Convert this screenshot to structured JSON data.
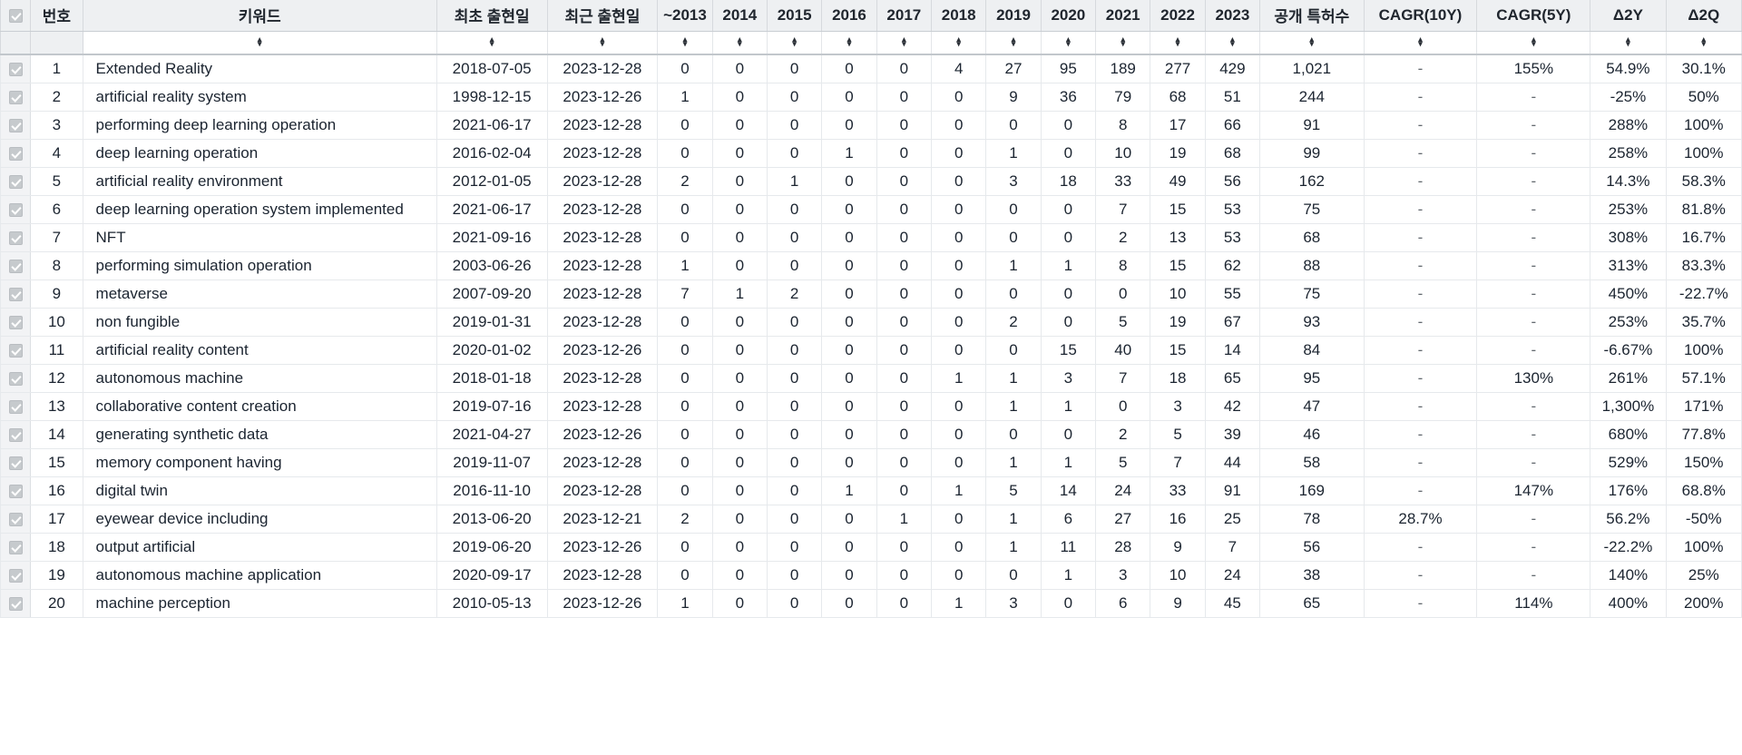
{
  "table": {
    "columns": [
      {
        "key": "check",
        "label": "",
        "sortable": false
      },
      {
        "key": "no",
        "label": "번호",
        "sortable": false
      },
      {
        "key": "kw",
        "label": "키워드",
        "sortable": true
      },
      {
        "key": "first",
        "label": "최초 출현일",
        "sortable": true
      },
      {
        "key": "last",
        "label": "최근 출현일",
        "sortable": true
      },
      {
        "key": "y2013",
        "label": "~2013",
        "sortable": true
      },
      {
        "key": "y2014",
        "label": "2014",
        "sortable": true
      },
      {
        "key": "y2015",
        "label": "2015",
        "sortable": true
      },
      {
        "key": "y2016",
        "label": "2016",
        "sortable": true
      },
      {
        "key": "y2017",
        "label": "2017",
        "sortable": true
      },
      {
        "key": "y2018",
        "label": "2018",
        "sortable": true
      },
      {
        "key": "y2019",
        "label": "2019",
        "sortable": true
      },
      {
        "key": "y2020",
        "label": "2020",
        "sortable": true
      },
      {
        "key": "y2021",
        "label": "2021",
        "sortable": true
      },
      {
        "key": "y2022",
        "label": "2022",
        "sortable": true
      },
      {
        "key": "y2023",
        "label": "2023",
        "sortable": true
      },
      {
        "key": "total",
        "label": "공개 특허수",
        "sortable": true
      },
      {
        "key": "cagr10",
        "label": "CAGR(10Y)",
        "sortable": true
      },
      {
        "key": "cagr5",
        "label": "CAGR(5Y)",
        "sortable": true
      },
      {
        "key": "d2y",
        "label": "Δ2Y",
        "sortable": true
      },
      {
        "key": "d2q",
        "label": "Δ2Q",
        "sortable": true
      }
    ],
    "sort_icon": {
      "up": "▴",
      "down": "▾"
    },
    "checkbox": {
      "checked": true,
      "glyph": "check-icon"
    },
    "rows": [
      {
        "no": "1",
        "kw": "Extended Reality",
        "first": "2018-07-05",
        "last": "2023-12-28",
        "years": [
          "0",
          "0",
          "0",
          "0",
          "0",
          "4",
          "27",
          "95",
          "189",
          "277",
          "429"
        ],
        "total": "1,021",
        "cagr10": "-",
        "cagr5": "155%",
        "d2y": "54.9%",
        "d2q": "30.1%"
      },
      {
        "no": "2",
        "kw": "artificial reality system",
        "first": "1998-12-15",
        "last": "2023-12-26",
        "years": [
          "1",
          "0",
          "0",
          "0",
          "0",
          "0",
          "9",
          "36",
          "79",
          "68",
          "51"
        ],
        "total": "244",
        "cagr10": "-",
        "cagr5": "-",
        "d2y": "-25%",
        "d2q": "50%"
      },
      {
        "no": "3",
        "kw": "performing deep learning operation",
        "first": "2021-06-17",
        "last": "2023-12-28",
        "years": [
          "0",
          "0",
          "0",
          "0",
          "0",
          "0",
          "0",
          "0",
          "8",
          "17",
          "66"
        ],
        "total": "91",
        "cagr10": "-",
        "cagr5": "-",
        "d2y": "288%",
        "d2q": "100%"
      },
      {
        "no": "4",
        "kw": "deep learning operation",
        "first": "2016-02-04",
        "last": "2023-12-28",
        "years": [
          "0",
          "0",
          "0",
          "1",
          "0",
          "0",
          "1",
          "0",
          "10",
          "19",
          "68"
        ],
        "total": "99",
        "cagr10": "-",
        "cagr5": "-",
        "d2y": "258%",
        "d2q": "100%"
      },
      {
        "no": "5",
        "kw": "artificial reality environment",
        "first": "2012-01-05",
        "last": "2023-12-28",
        "years": [
          "2",
          "0",
          "1",
          "0",
          "0",
          "0",
          "3",
          "18",
          "33",
          "49",
          "56"
        ],
        "total": "162",
        "cagr10": "-",
        "cagr5": "-",
        "d2y": "14.3%",
        "d2q": "58.3%"
      },
      {
        "no": "6",
        "kw": "deep learning operation system implemented",
        "first": "2021-06-17",
        "last": "2023-12-28",
        "years": [
          "0",
          "0",
          "0",
          "0",
          "0",
          "0",
          "0",
          "0",
          "7",
          "15",
          "53"
        ],
        "total": "75",
        "cagr10": "-",
        "cagr5": "-",
        "d2y": "253%",
        "d2q": "81.8%"
      },
      {
        "no": "7",
        "kw": "NFT",
        "first": "2021-09-16",
        "last": "2023-12-28",
        "years": [
          "0",
          "0",
          "0",
          "0",
          "0",
          "0",
          "0",
          "0",
          "2",
          "13",
          "53"
        ],
        "total": "68",
        "cagr10": "-",
        "cagr5": "-",
        "d2y": "308%",
        "d2q": "16.7%"
      },
      {
        "no": "8",
        "kw": "performing simulation operation",
        "first": "2003-06-26",
        "last": "2023-12-28",
        "years": [
          "1",
          "0",
          "0",
          "0",
          "0",
          "0",
          "1",
          "1",
          "8",
          "15",
          "62"
        ],
        "total": "88",
        "cagr10": "-",
        "cagr5": "-",
        "d2y": "313%",
        "d2q": "83.3%"
      },
      {
        "no": "9",
        "kw": "metaverse",
        "first": "2007-09-20",
        "last": "2023-12-28",
        "years": [
          "7",
          "1",
          "2",
          "0",
          "0",
          "0",
          "0",
          "0",
          "0",
          "10",
          "55"
        ],
        "total": "75",
        "cagr10": "-",
        "cagr5": "-",
        "d2y": "450%",
        "d2q": "-22.7%"
      },
      {
        "no": "10",
        "kw": "non fungible",
        "first": "2019-01-31",
        "last": "2023-12-28",
        "years": [
          "0",
          "0",
          "0",
          "0",
          "0",
          "0",
          "2",
          "0",
          "5",
          "19",
          "67"
        ],
        "total": "93",
        "cagr10": "-",
        "cagr5": "-",
        "d2y": "253%",
        "d2q": "35.7%"
      },
      {
        "no": "11",
        "kw": "artificial reality content",
        "first": "2020-01-02",
        "last": "2023-12-26",
        "years": [
          "0",
          "0",
          "0",
          "0",
          "0",
          "0",
          "0",
          "15",
          "40",
          "15",
          "14"
        ],
        "total": "84",
        "cagr10": "-",
        "cagr5": "-",
        "d2y": "-6.67%",
        "d2q": "100%"
      },
      {
        "no": "12",
        "kw": "autonomous machine",
        "first": "2018-01-18",
        "last": "2023-12-28",
        "years": [
          "0",
          "0",
          "0",
          "0",
          "0",
          "1",
          "1",
          "3",
          "7",
          "18",
          "65"
        ],
        "total": "95",
        "cagr10": "-",
        "cagr5": "130%",
        "d2y": "261%",
        "d2q": "57.1%"
      },
      {
        "no": "13",
        "kw": "collaborative content creation",
        "first": "2019-07-16",
        "last": "2023-12-28",
        "years": [
          "0",
          "0",
          "0",
          "0",
          "0",
          "0",
          "1",
          "1",
          "0",
          "3",
          "42"
        ],
        "total": "47",
        "cagr10": "-",
        "cagr5": "-",
        "d2y": "1,300%",
        "d2q": "171%"
      },
      {
        "no": "14",
        "kw": "generating synthetic data",
        "first": "2021-04-27",
        "last": "2023-12-26",
        "years": [
          "0",
          "0",
          "0",
          "0",
          "0",
          "0",
          "0",
          "0",
          "2",
          "5",
          "39"
        ],
        "total": "46",
        "cagr10": "-",
        "cagr5": "-",
        "d2y": "680%",
        "d2q": "77.8%"
      },
      {
        "no": "15",
        "kw": "memory component having",
        "first": "2019-11-07",
        "last": "2023-12-28",
        "years": [
          "0",
          "0",
          "0",
          "0",
          "0",
          "0",
          "1",
          "1",
          "5",
          "7",
          "44"
        ],
        "total": "58",
        "cagr10": "-",
        "cagr5": "-",
        "d2y": "529%",
        "d2q": "150%"
      },
      {
        "no": "16",
        "kw": "digital twin",
        "first": "2016-11-10",
        "last": "2023-12-28",
        "years": [
          "0",
          "0",
          "0",
          "1",
          "0",
          "1",
          "5",
          "14",
          "24",
          "33",
          "91"
        ],
        "total": "169",
        "cagr10": "-",
        "cagr5": "147%",
        "d2y": "176%",
        "d2q": "68.8%"
      },
      {
        "no": "17",
        "kw": "eyewear device including",
        "first": "2013-06-20",
        "last": "2023-12-21",
        "years": [
          "2",
          "0",
          "0",
          "0",
          "1",
          "0",
          "1",
          "6",
          "27",
          "16",
          "25"
        ],
        "total": "78",
        "cagr10": "28.7%",
        "cagr5": "-",
        "d2y": "56.2%",
        "d2q": "-50%"
      },
      {
        "no": "18",
        "kw": "output artificial",
        "first": "2019-06-20",
        "last": "2023-12-26",
        "years": [
          "0",
          "0",
          "0",
          "0",
          "0",
          "0",
          "1",
          "11",
          "28",
          "9",
          "7"
        ],
        "total": "56",
        "cagr10": "-",
        "cagr5": "-",
        "d2y": "-22.2%",
        "d2q": "100%"
      },
      {
        "no": "19",
        "kw": "autonomous machine application",
        "first": "2020-09-17",
        "last": "2023-12-28",
        "years": [
          "0",
          "0",
          "0",
          "0",
          "0",
          "0",
          "0",
          "1",
          "3",
          "10",
          "24"
        ],
        "total": "38",
        "cagr10": "-",
        "cagr5": "-",
        "d2y": "140%",
        "d2q": "25%"
      },
      {
        "no": "20",
        "kw": "machine perception",
        "first": "2010-05-13",
        "last": "2023-12-26",
        "years": [
          "1",
          "0",
          "0",
          "0",
          "0",
          "1",
          "3",
          "0",
          "6",
          "9",
          "45"
        ],
        "total": "65",
        "cagr10": "-",
        "cagr5": "114%",
        "d2y": "400%",
        "d2q": "200%"
      }
    ]
  }
}
